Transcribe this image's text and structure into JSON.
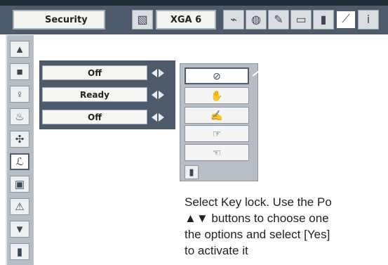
{
  "header": {
    "menu_title": "Security",
    "signal_mode": "XGA 6"
  },
  "top_icons": [
    "picture-adjust-icon",
    "signal-icon",
    "screen-icon",
    "language-icon",
    "status-icon",
    "setting-icon",
    "info-icon"
  ],
  "side_menu": [
    "up-arrow-icon",
    "image-select-icon",
    "lamp-icon",
    "pc-adjust-icon",
    "fan-icon",
    "security-icon",
    "screen-icon",
    "warning-icon",
    "down-arrow-icon",
    "exit-icon"
  ],
  "settings": [
    {
      "value": "Off"
    },
    {
      "value": "Ready"
    },
    {
      "value": "Off"
    }
  ],
  "key_lock_options": [
    "off-icon",
    "projector-lock-icon",
    "remote-lock-icon",
    "projector-remote-lock-icon",
    "remote-projector-lock-icon"
  ],
  "exit_label_icon": "exit-icon",
  "help_lines": [
    "Select Key lock. Use the Po",
    "▲▼ buttons to choose one",
    "the options and select [Yes]",
    "to activate it"
  ]
}
